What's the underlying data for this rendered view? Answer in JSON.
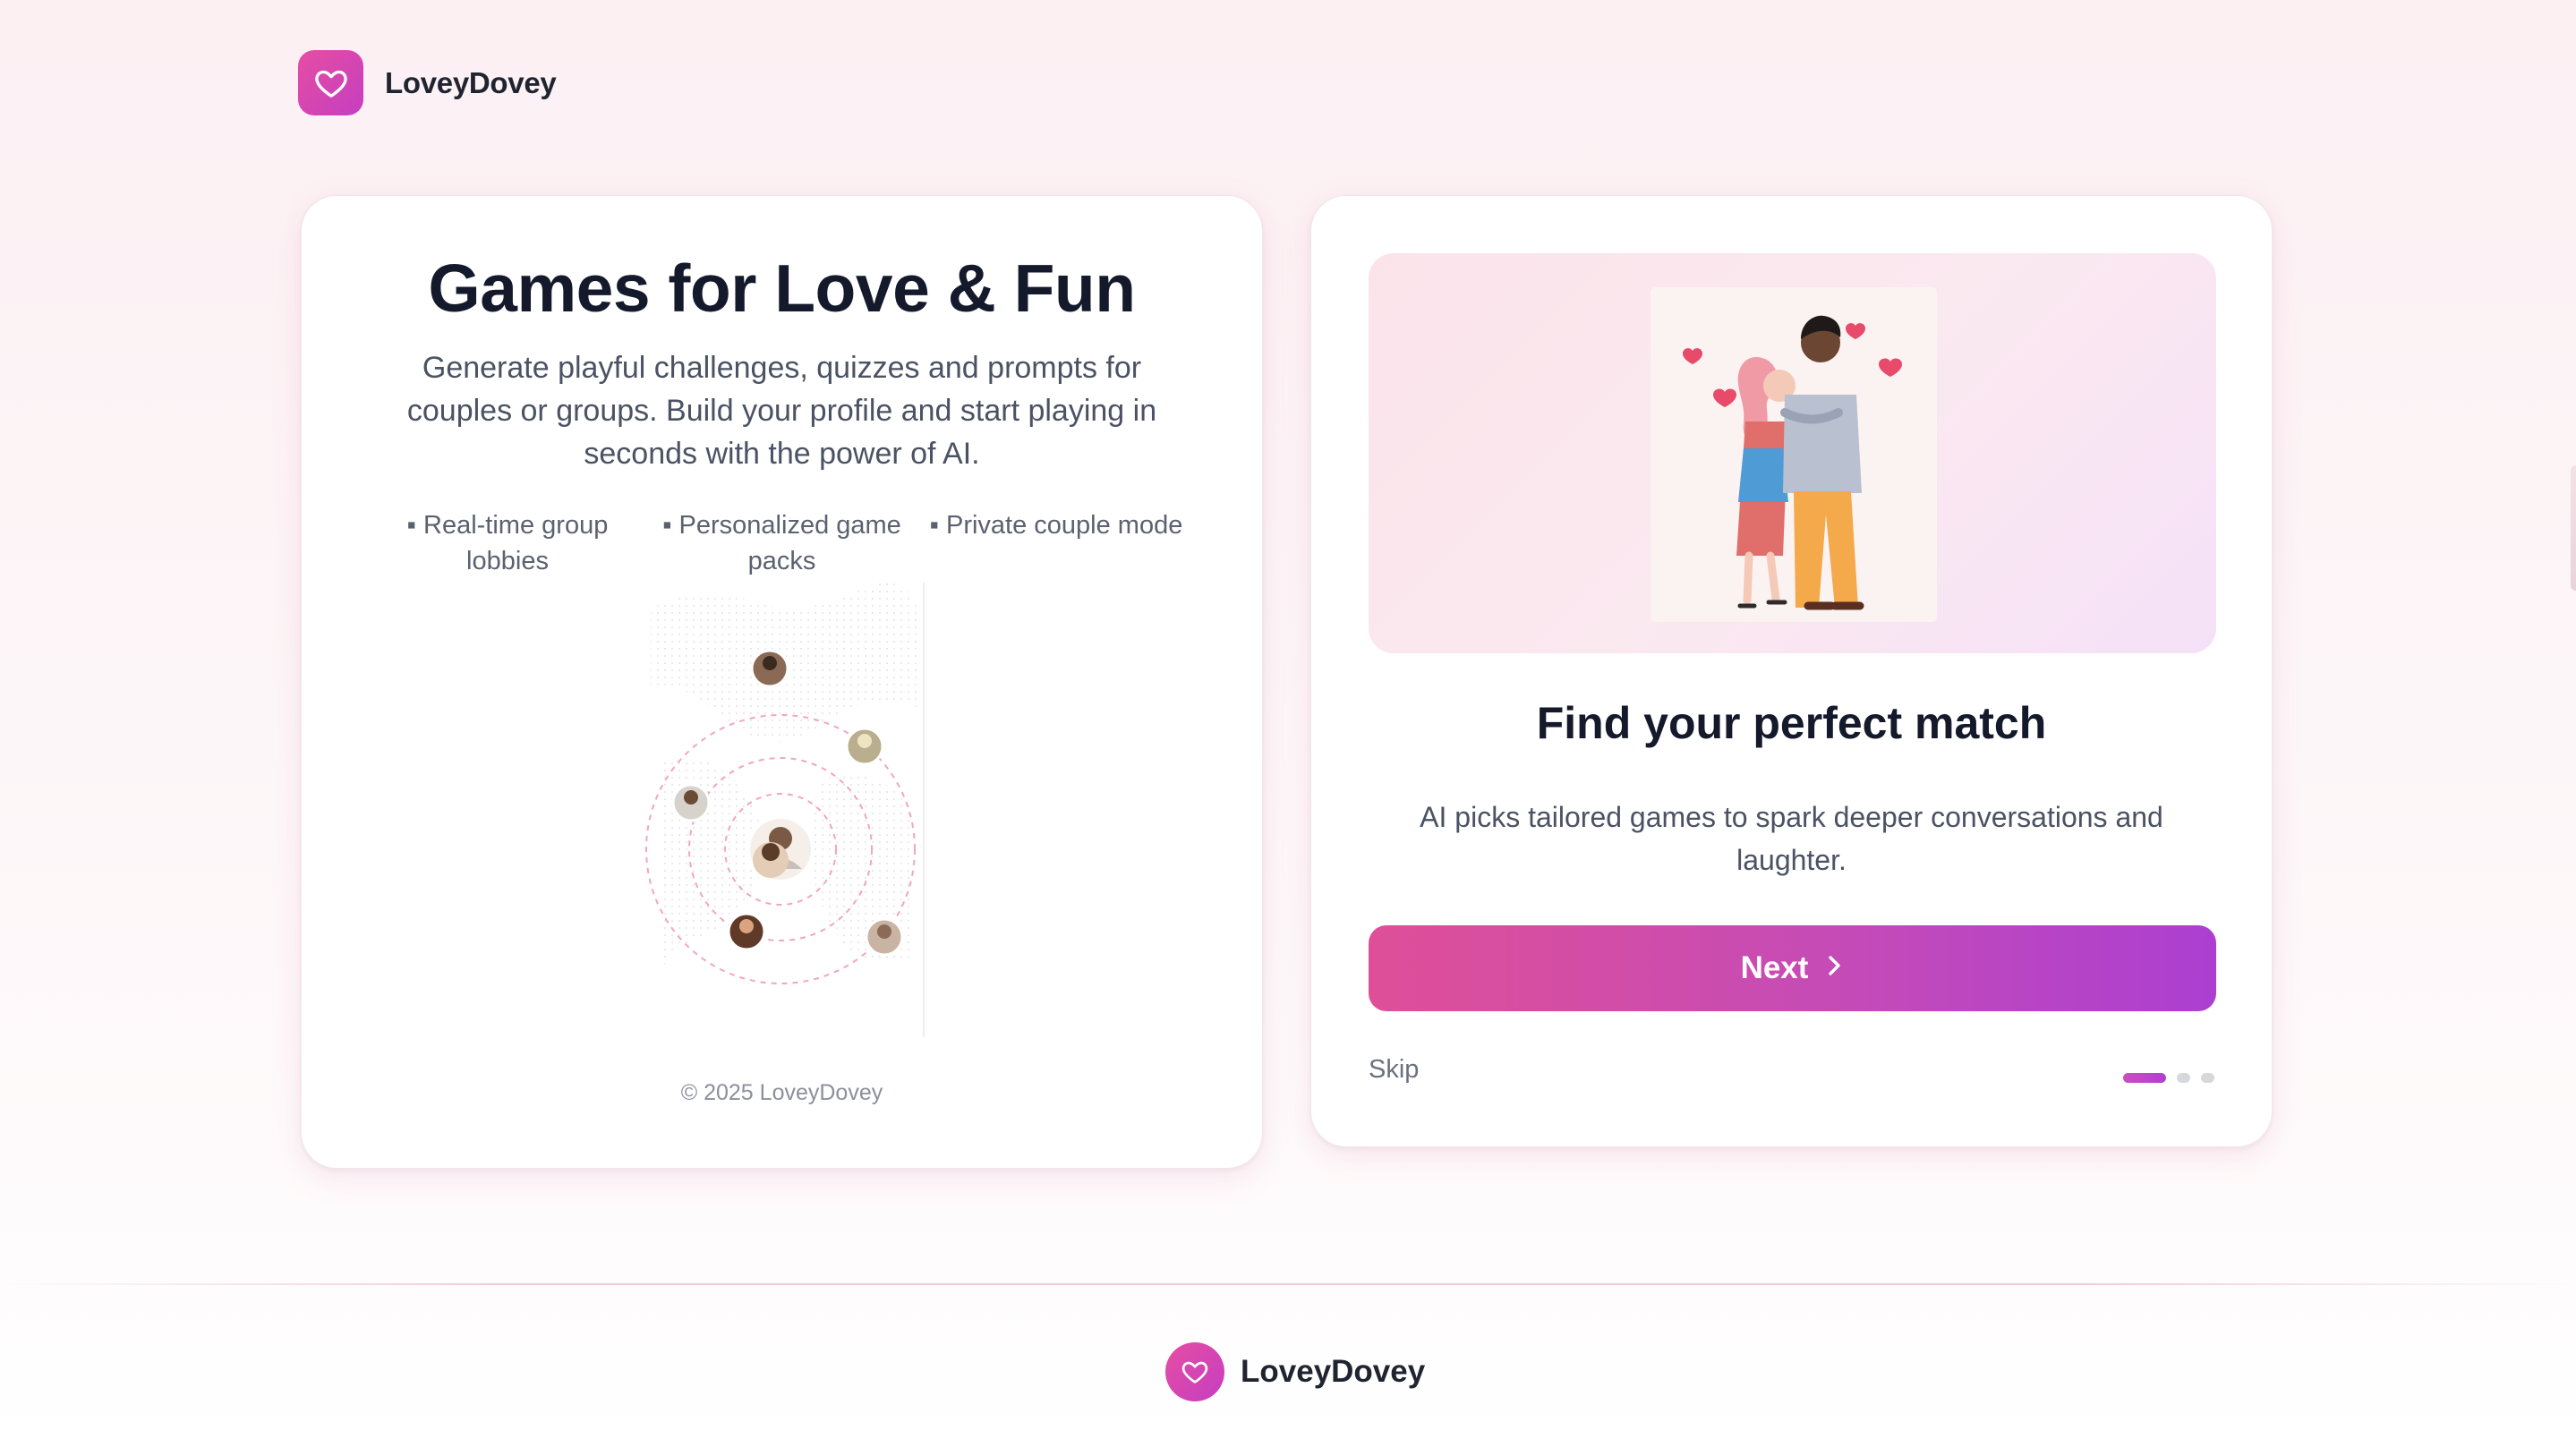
{
  "brand": {
    "name": "LoveyDovey",
    "logo_icon": "heart-icon",
    "accent_gradient": [
      "#e64ea3",
      "#c63ec1"
    ]
  },
  "hero": {
    "title": "Games for Love & Fun",
    "subtitle": "Generate playful challenges, quizzes and prompts for couples or groups. Build your profile and start playing in seconds with the power of AI.",
    "features": [
      "▪ Real-time group lobbies",
      "▪ Personalized game packs",
      "▪ Private couple mode"
    ],
    "copyright": "© 2025 LoveyDovey"
  },
  "onboarding": {
    "title": "Find your perfect match",
    "subtitle": "AI picks tailored games to spark deeper conversations and laughter.",
    "next_label": "Next",
    "skip_label": "Skip",
    "step_current": 1,
    "step_total": 3,
    "button_gradient": [
      "#df4f98",
      "#ac3fd1"
    ]
  },
  "footer": {
    "brand_name": "LoveyDovey"
  }
}
